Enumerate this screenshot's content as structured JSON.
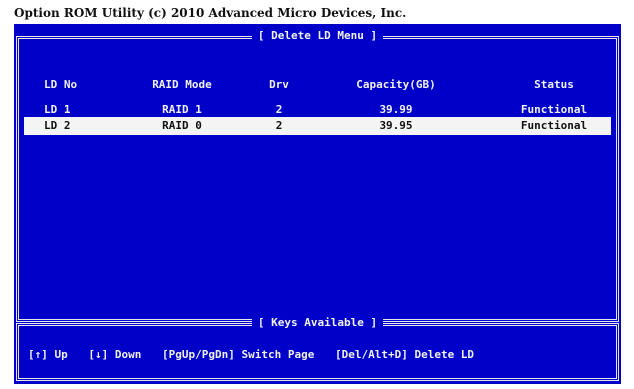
{
  "header": {
    "title": "Option ROM Utility (c) 2010 Advanced Micro Devices, Inc."
  },
  "menu": {
    "title": "[ Delete LD Menu ]",
    "columns": [
      "LD No",
      "RAID Mode",
      "Drv",
      "Capacity(GB)",
      "Status"
    ],
    "rows": [
      {
        "ld": "LD  1",
        "mode": "RAID 1",
        "drv": "2",
        "capacity": "39.99",
        "status": "Functional",
        "selected": false
      },
      {
        "ld": "LD  2",
        "mode": "RAID 0",
        "drv": "2",
        "capacity": "39.95",
        "status": "Functional",
        "selected": true
      }
    ]
  },
  "keys": {
    "title": "[ Keys Available ]",
    "items": [
      {
        "key": "[↑]",
        "action": "Up"
      },
      {
        "key": "[↓]",
        "action": "Down"
      },
      {
        "key": "[PgUp/PgDn]",
        "action": "Switch Page"
      },
      {
        "key": "[Del/Alt+D]",
        "action": "Delete LD"
      }
    ]
  },
  "colors": {
    "background": "#0000c8",
    "text": "#f0f0f0",
    "highlight_bg": "#f4f4f4",
    "highlight_text": "#111111"
  }
}
